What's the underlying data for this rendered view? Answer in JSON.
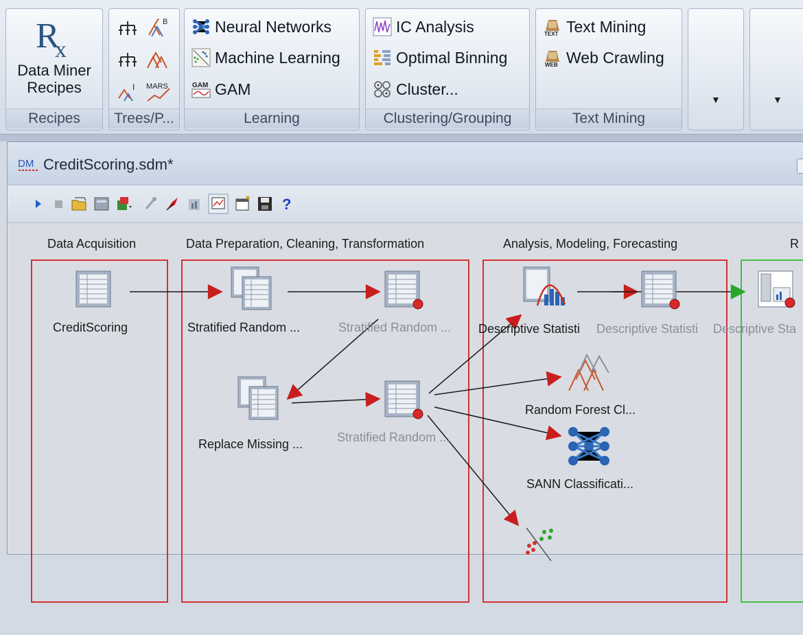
{
  "ribbon": {
    "recipes_button": "Data Miner Recipes",
    "recipes_button_line1": "Data Miner",
    "recipes_button_line2": "Recipes",
    "groups": [
      {
        "label": "Recipes"
      },
      {
        "label": "Trees/P..."
      },
      {
        "label": "Learning"
      },
      {
        "label": "Clustering/Grouping"
      },
      {
        "label": "Text Mining"
      }
    ],
    "learning": {
      "neural_networks": "Neural Networks",
      "machine_learning": "Machine Learning",
      "gam": "GAM"
    },
    "clustering": {
      "ic_analysis": "IC Analysis",
      "optimal_binning": "Optimal Binning",
      "cluster": "Cluster..."
    },
    "text_mining": {
      "text_mining": "Text Mining",
      "web_crawling": "Web Crawling"
    },
    "icon_text": {
      "rx": "Rx",
      "gam": "GAM",
      "text": "TEXT",
      "web": "WEB",
      "b": "B",
      "i": "I",
      "mars": "MARS"
    },
    "dropdown_glyph": "▼"
  },
  "document": {
    "title": "CreditScoring.sdm*",
    "title_icon_text": "DM",
    "help_glyph": "?"
  },
  "columns": [
    {
      "label": "Data Acquisition"
    },
    {
      "label": "Data Preparation, Cleaning, Transformation"
    },
    {
      "label": "Analysis, Modeling, Forecasting"
    },
    {
      "label": "R"
    }
  ],
  "nodes": {
    "credit_scoring": "CreditScoring",
    "stratified_1": "Stratified Random ...",
    "stratified_2": "Stratified Random ...",
    "replace_missing": "Replace Missing ...",
    "stratified_3": "Stratified Random ...",
    "descriptive_1": "Descriptive Statisti",
    "descriptive_2": "Descriptive Statisti",
    "descriptive_3": "Descriptive Sta",
    "random_forest": "Random Forest Cl...",
    "sann": "SANN Classificati..."
  },
  "colors": {
    "red_frame": "#d23232",
    "green_frame": "#43c043",
    "arrow_red": "#c81e1e",
    "arrow_green": "#2aa52a"
  }
}
